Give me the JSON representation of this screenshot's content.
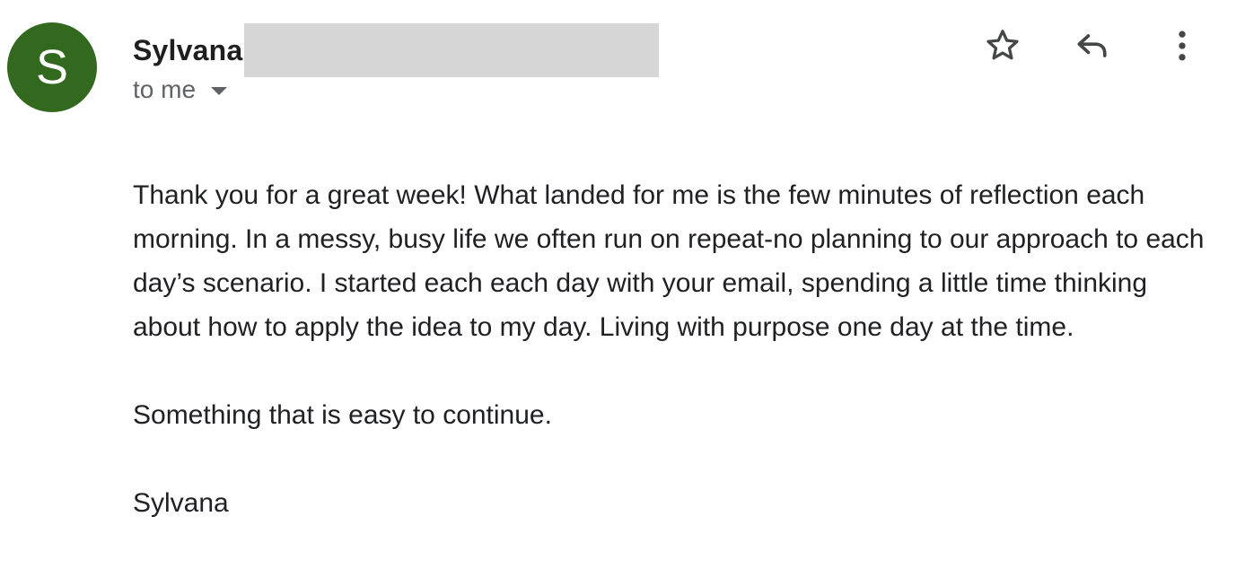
{
  "sender": {
    "avatar_letter": "S",
    "avatar_color": "#33691e",
    "name": "Sylvana",
    "recipient_label": "to me"
  },
  "actions": {
    "star_icon": "star-outline-icon",
    "reply_icon": "reply-icon",
    "more_icon": "more-vertical-icon"
  },
  "message": {
    "paragraph": "Thank you for a great week! What landed for me is the few minutes of reflection each morning. In a messy, busy life we often run on repeat-no planning to our approach to each day’s scenario. I started each each day with your email, spending a little time thinking about how to apply the idea to my day. Living with purpose  one day at the time.",
    "line2": "Something that is easy to continue.",
    "signature": "Sylvana"
  }
}
